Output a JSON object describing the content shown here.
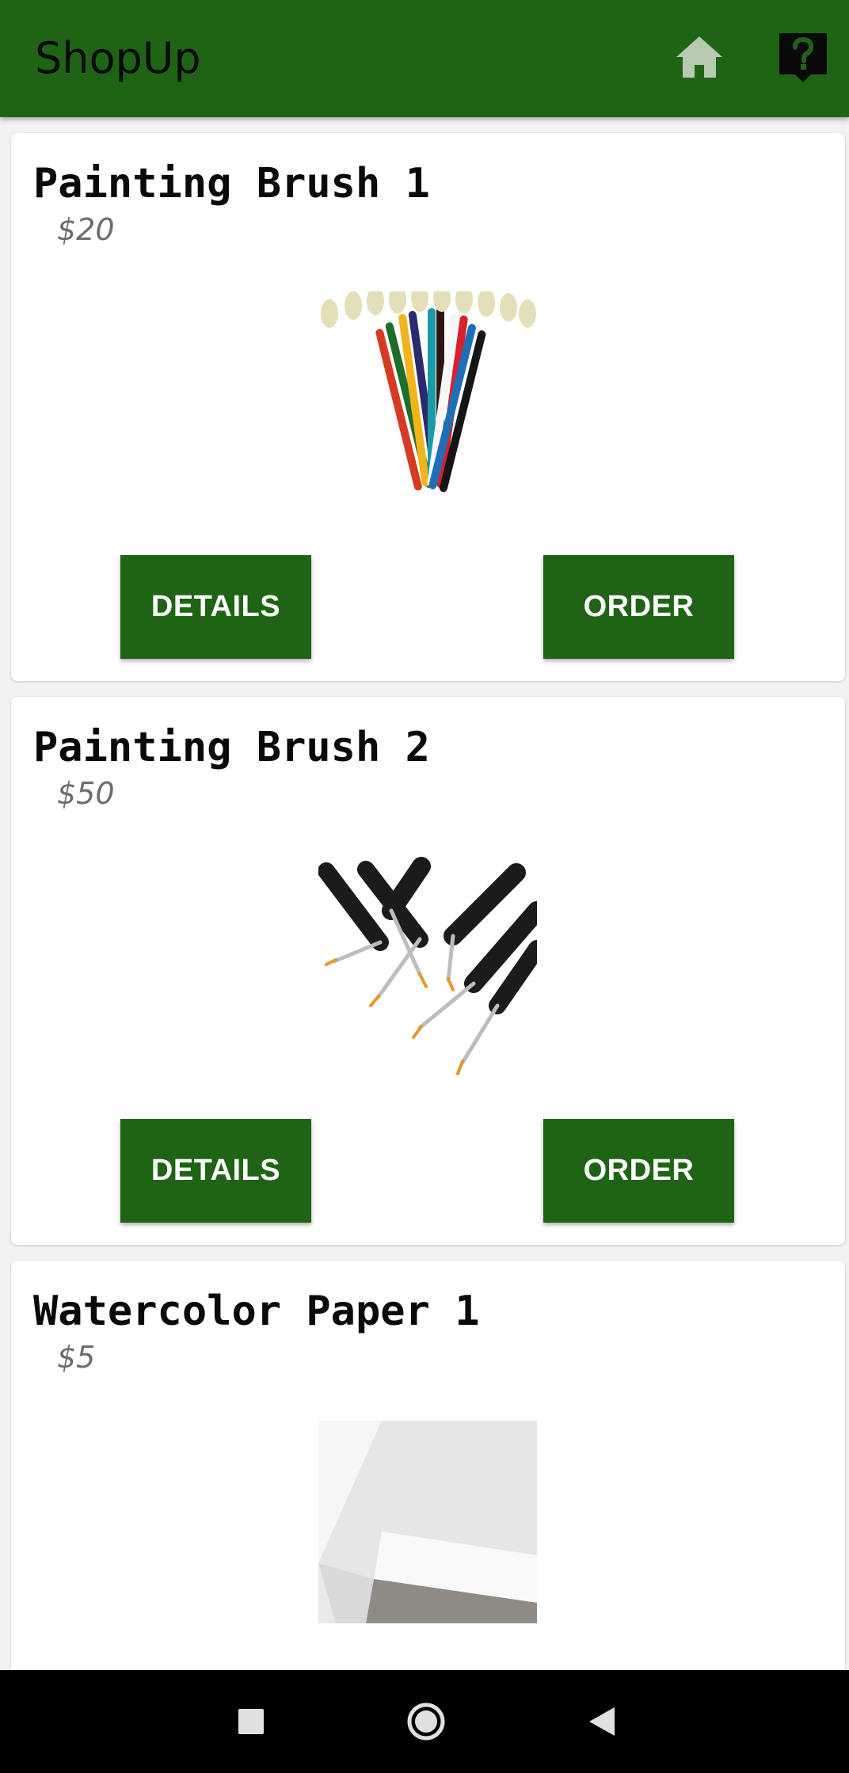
{
  "app": {
    "title": "ShopUp",
    "home_icon": "home-icon",
    "help_icon": "help-icon"
  },
  "products": [
    {
      "name": "Painting Brush 1",
      "price": "$20",
      "image": "painting-brush-set-image",
      "details_label": "DETAILS",
      "order_label": "ORDER"
    },
    {
      "name": "Painting Brush 2",
      "price": "$50",
      "image": "fine-detail-brushes-image",
      "details_label": "DETAILS",
      "order_label": "ORDER"
    },
    {
      "name": "Watercolor Paper 1",
      "price": "$5",
      "image": "watercolor-paper-image"
    }
  ],
  "navbar": {
    "recents_icon": "square-recents-icon",
    "home_icon": "circle-home-icon",
    "back_icon": "triangle-back-icon"
  },
  "colors": {
    "primary": "#1e6414",
    "price": "#6d6d6d",
    "navbar": "#000000"
  }
}
